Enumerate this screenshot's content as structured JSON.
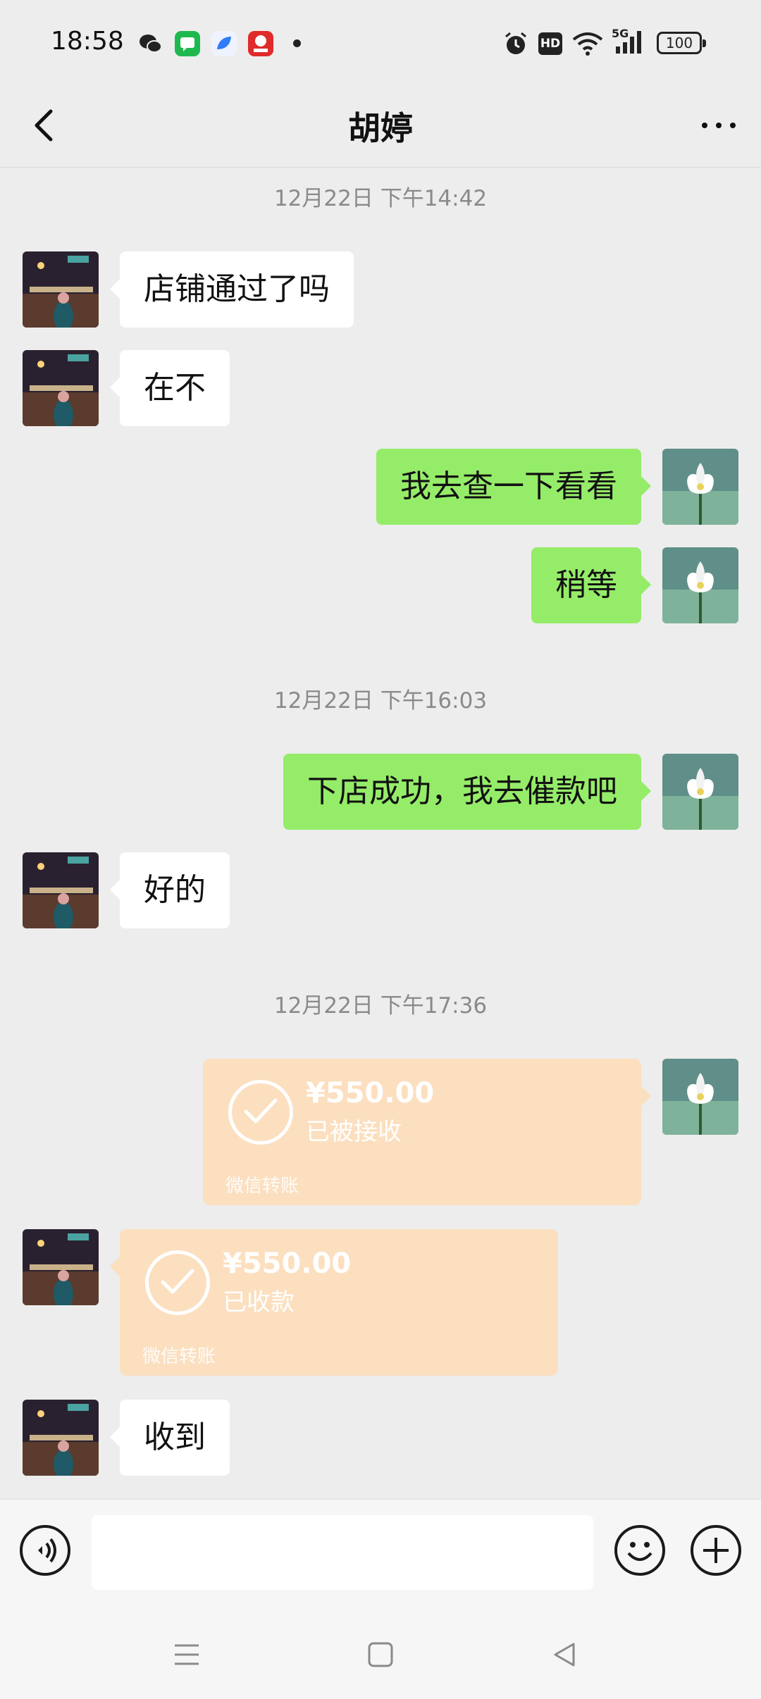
{
  "status_bar": {
    "time": "18:58",
    "notification_icons": [
      "wechat-icon",
      "messages-icon",
      "app-icon",
      "shopping-618-icon"
    ],
    "system_icons": [
      "alarm-icon",
      "hd-icon",
      "wifi-icon",
      "signal-5g-icon"
    ],
    "hd_label": "HD",
    "network_label": "5G",
    "battery": "100"
  },
  "header": {
    "title": "胡婷"
  },
  "messages": [
    {
      "type": "time",
      "text": "12月22日 下午14:42"
    },
    {
      "type": "text",
      "side": "in",
      "text": "店铺通过了吗"
    },
    {
      "type": "text",
      "side": "in",
      "text": "在不"
    },
    {
      "type": "text",
      "side": "out",
      "text": "我去查一下看看"
    },
    {
      "type": "text",
      "side": "out",
      "text": "稍等"
    },
    {
      "type": "time",
      "text": "12月22日 下午16:03"
    },
    {
      "type": "text",
      "side": "out",
      "text": "下店成功，我去催款吧"
    },
    {
      "type": "text",
      "side": "in",
      "text": "好的"
    },
    {
      "type": "time",
      "text": "12月22日 下午17:36"
    },
    {
      "type": "transfer",
      "side": "out",
      "amount": "¥550.00",
      "status": "已被接收",
      "label": "微信转账"
    },
    {
      "type": "transfer",
      "side": "in",
      "amount": "¥550.00",
      "status": "已收款",
      "label": "微信转账"
    },
    {
      "type": "text",
      "side": "in",
      "text": "收到"
    }
  ],
  "input_bar": {
    "voice": "voice-icon",
    "emoji": "emoji-icon",
    "add": "plus-icon",
    "input_value": ""
  },
  "colors": {
    "background": "#ededed",
    "out_bubble": "#95ec69",
    "in_bubble": "#ffffff",
    "transfer_card": "#fbdfbf"
  }
}
